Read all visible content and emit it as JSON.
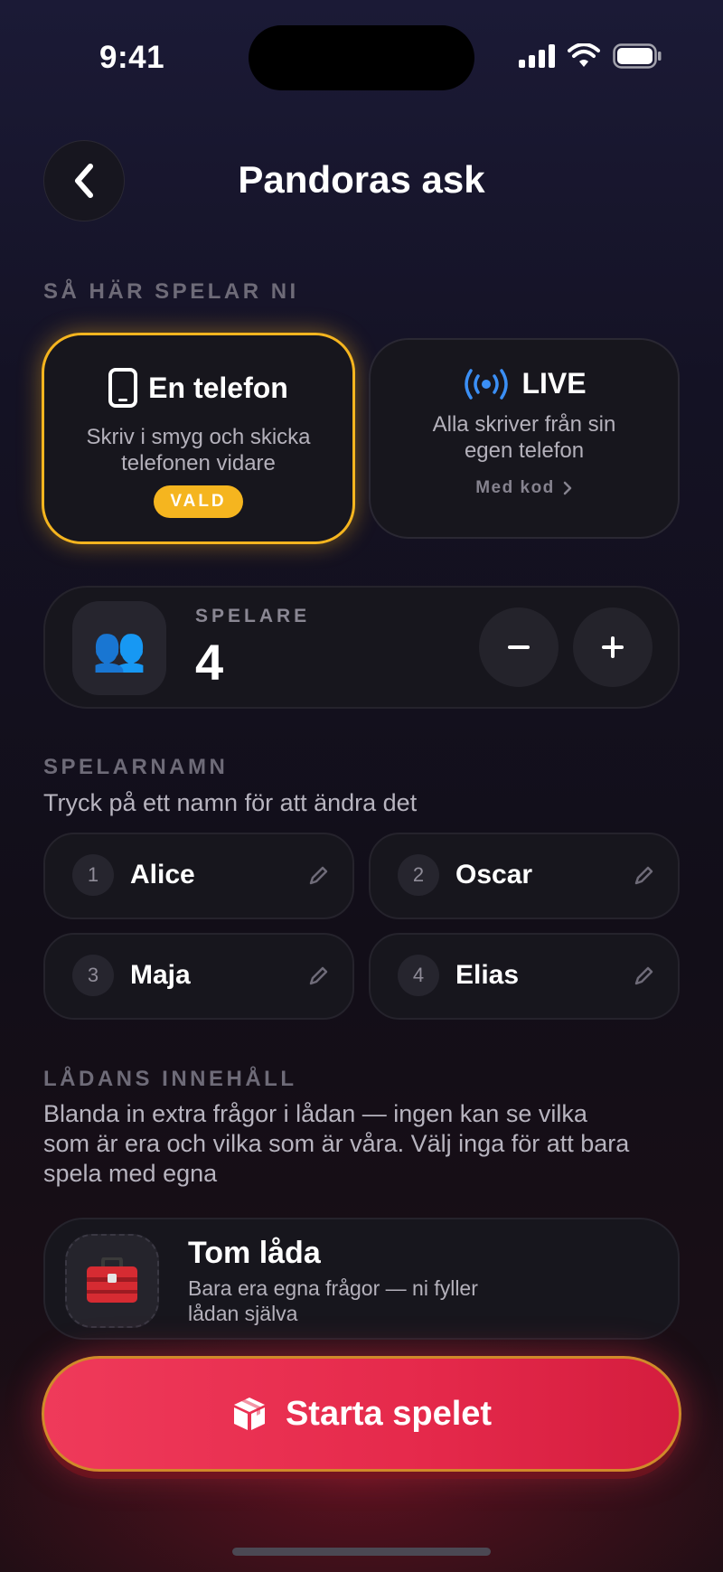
{
  "status_bar": {
    "time": "9:41"
  },
  "header": {
    "title": "Pandoras ask"
  },
  "mode_section": {
    "label": "SÅ HÄR SPELAR NI",
    "one_phone": {
      "title": "En telefon",
      "subtitle_line1": "Skriv i smyg och skicka",
      "subtitle_line2": "telefonen vidare",
      "badge": "VALD",
      "icon": "phone-icon"
    },
    "live": {
      "title": "LIVE",
      "subtitle_line1": "Alla skriver från sin",
      "subtitle_line2": "egen telefon",
      "link": "Med kod",
      "icon": "broadcast-icon"
    }
  },
  "players": {
    "label": "SPELARE",
    "count": "4",
    "avatar": "👥"
  },
  "names_section": {
    "label": "SPELARNAMN",
    "hint": "Tryck på ett namn för att ändra det",
    "players": [
      {
        "number": "1",
        "name": "Alice"
      },
      {
        "number": "2",
        "name": "Oscar"
      },
      {
        "number": "3",
        "name": "Maja"
      },
      {
        "number": "4",
        "name": "Elias"
      }
    ]
  },
  "box_section": {
    "label": "LÅDANS INNEHÅLL",
    "desc_line1": "Blanda in extra frågor i lådan — ingen kan se vilka",
    "desc_line2": "som är era och vilka som är våra. Välj inga för att bara",
    "desc_line3": "spela med egna",
    "option": {
      "title": "Tom låda",
      "subtitle_line1": "Bara era egna frågor — ni fyller",
      "subtitle_line2": "lådan själva",
      "icon": "🧰"
    }
  },
  "start_button": {
    "label": "Starta spelet"
  },
  "colors": {
    "accent": "#f5b51f",
    "cta": "#e5294b",
    "live_blue": "#3b8ff5"
  }
}
